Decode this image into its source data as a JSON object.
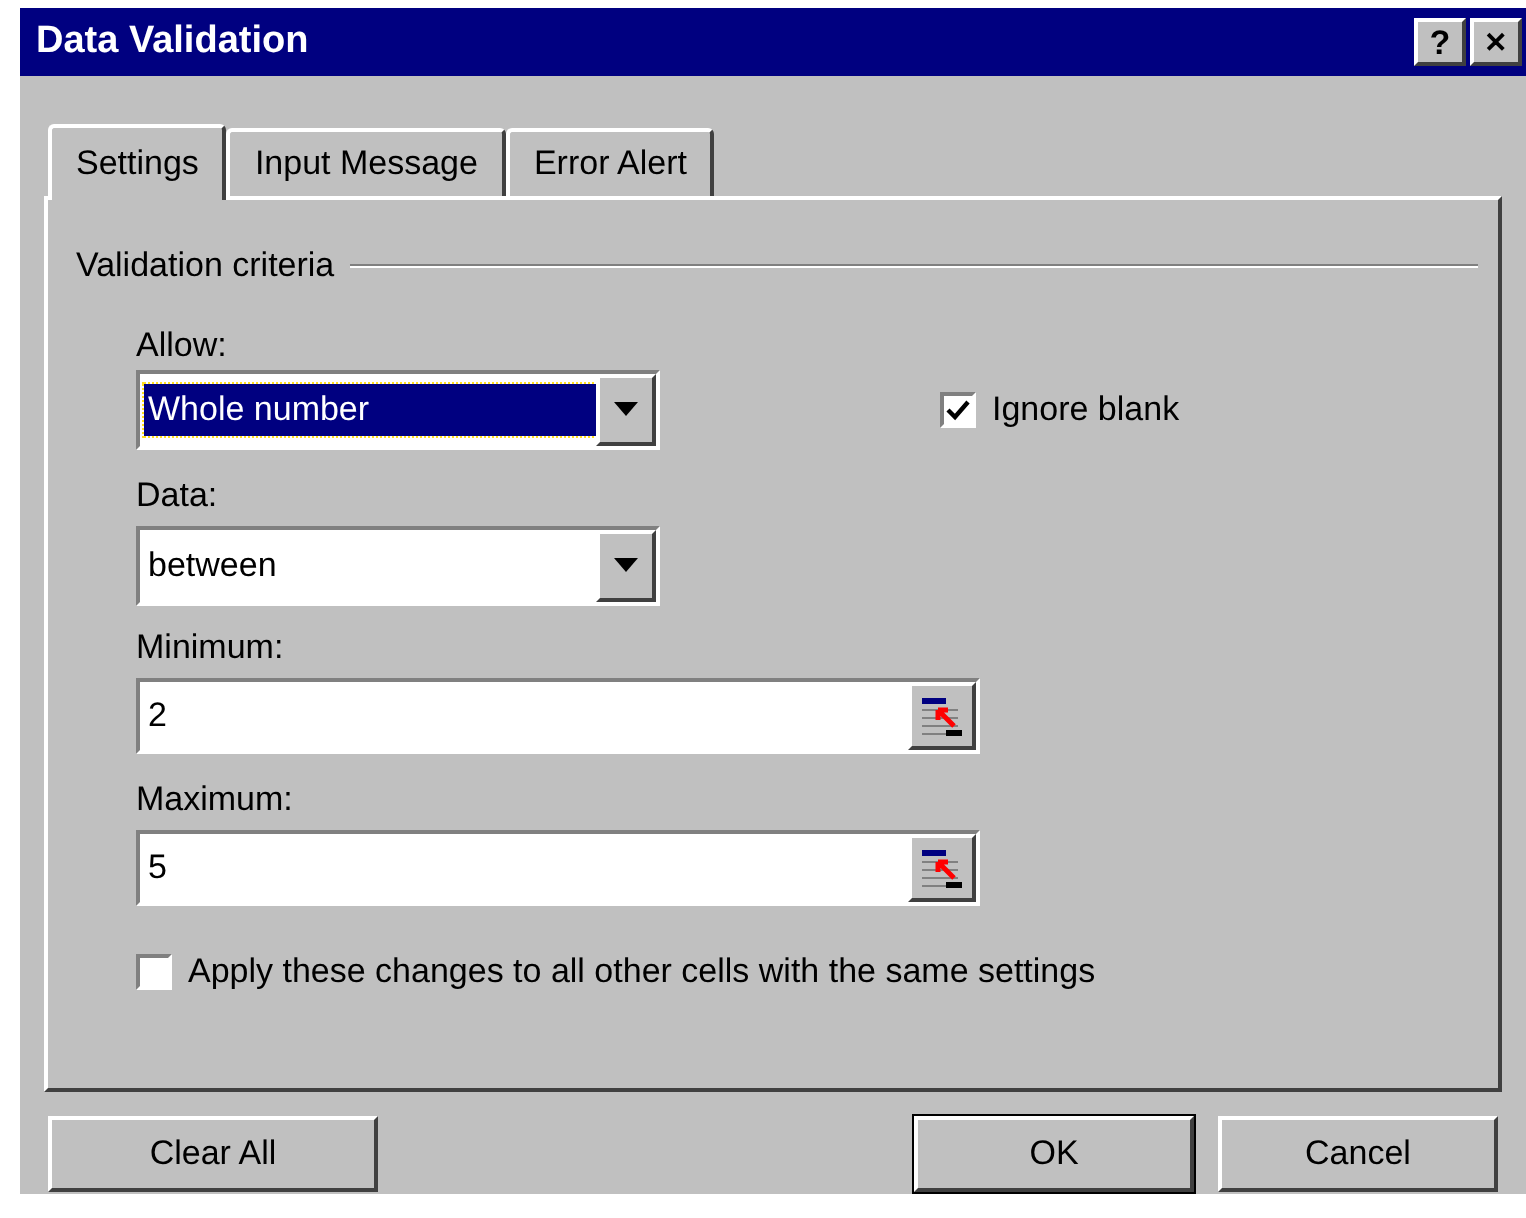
{
  "window": {
    "title": "Data Validation",
    "controls": [
      {
        "kind": "help",
        "label": "?"
      },
      {
        "kind": "close",
        "label": "✕"
      }
    ]
  },
  "tabs": [
    {
      "label": "Settings",
      "selected": true
    },
    {
      "label": "Input Message",
      "selected": false
    },
    {
      "label": "Error Alert",
      "selected": false
    }
  ],
  "group": {
    "title": "Validation criteria"
  },
  "allow": {
    "label": "Allow:",
    "value": "Whole number",
    "focused": true
  },
  "ignore_blank": {
    "label": "Ignore blank",
    "checked": true
  },
  "data": {
    "label": "Data:",
    "value": "between",
    "focused": false
  },
  "minimum": {
    "label": "Minimum:",
    "value": "2"
  },
  "maximum": {
    "label": "Maximum:",
    "value": "5"
  },
  "apply_all": {
    "label": "Apply these changes to all other cells with the same settings",
    "checked": false
  },
  "buttons": [
    {
      "label": "Clear All",
      "default": false
    },
    {
      "label": "OK",
      "default": true
    },
    {
      "label": "Cancel",
      "default": false
    }
  ]
}
